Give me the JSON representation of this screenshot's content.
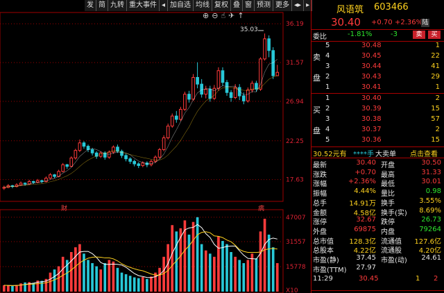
{
  "toolbar": [
    "发",
    "简",
    "九转",
    "重大事件",
    "◂",
    "加自选",
    "均线",
    "复权",
    "叠",
    "窗",
    "预测",
    "更多",
    "◂▸",
    "▸"
  ],
  "top_icons": [
    "⊕",
    "⊖",
    "☝",
    "✈",
    "↑"
  ],
  "header": {
    "name": "风语筑",
    "code": "603466",
    "price": "30.40",
    "change": "+0.70",
    "pct": "+2.36%",
    "tag": "陆"
  },
  "weibi": {
    "label": "委比",
    "pct": "-1.81%",
    "diff": "-3",
    "buy": "买",
    "sell": "卖"
  },
  "sell_orders": [
    {
      "lv": "5",
      "price": "30.48",
      "vol": "1"
    },
    {
      "lv": "4",
      "price": "30.45",
      "vol": "22"
    },
    {
      "lv": "3",
      "price": "30.44",
      "vol": "41"
    },
    {
      "lv": "2",
      "price": "30.43",
      "vol": "29"
    },
    {
      "lv": "1",
      "price": "30.41",
      "vol": "1"
    }
  ],
  "sell_label": [
    "卖",
    "盘"
  ],
  "buy_orders": [
    {
      "lv": "1",
      "price": "30.40",
      "vol": "2"
    },
    {
      "lv": "2",
      "price": "30.39",
      "vol": "15"
    },
    {
      "lv": "3",
      "price": "30.38",
      "vol": "57"
    },
    {
      "lv": "4",
      "price": "30.37",
      "vol": "2"
    },
    {
      "lv": "5",
      "price": "30.36",
      "vol": "15"
    }
  ],
  "buy_label": [
    "买",
    "盘"
  ],
  "big_order": {
    "text1": "30.52元有",
    "text2": "****手",
    "text3": "大卖单",
    "text4": "点击查看"
  },
  "stats": [
    {
      "k1": "最新",
      "v1": "30.40",
      "c1": "red",
      "k2": "开盘",
      "v2": "30.50",
      "c2": "red"
    },
    {
      "k1": "涨跌",
      "v1": "+0.70",
      "c1": "red",
      "k2": "最高",
      "v2": "31.33",
      "c2": "red"
    },
    {
      "k1": "涨幅",
      "v1": "+2.36%",
      "c1": "red",
      "k2": "最低",
      "v2": "30.01",
      "c2": "red"
    },
    {
      "k1": "振幅",
      "v1": "4.44%",
      "c1": "yellow",
      "k2": "量比",
      "v2": "0.98",
      "c2": "green"
    },
    {
      "k1": "总手",
      "v1": "14.91万",
      "c1": "yellow",
      "k2": "换手",
      "v2": "3.55%",
      "c2": "yellow"
    },
    {
      "k1": "金额",
      "v1": "4.58亿",
      "c1": "yellow",
      "k2": "换手(实)",
      "v2": "8.69%",
      "c2": "yellow"
    },
    {
      "k1": "涨停",
      "v1": "32.67",
      "c1": "red",
      "k2": "跌停",
      "v2": "26.73",
      "c2": "green"
    },
    {
      "k1": "外盘",
      "v1": "69875",
      "c1": "red",
      "k2": "内盘",
      "v2": "79264",
      "c2": "green"
    },
    {
      "k1": "总市值",
      "v1": "128.3亿",
      "c1": "yellow",
      "k2": "流通值",
      "v2": "127.6亿",
      "c2": "yellow"
    },
    {
      "k1": "总股本",
      "v1": "4.22亿",
      "c1": "yellow",
      "k2": "流通股",
      "v2": "4.20亿",
      "c2": "yellow"
    },
    {
      "k1": "市盈(静)",
      "v1": "37.45",
      "c1": "white",
      "k2": "市盈(动)",
      "v2": "24.61",
      "c2": "white"
    },
    {
      "k1": "市盈(TTM)",
      "v1": "27.97",
      "c1": "white",
      "k2": "",
      "v2": "",
      "c2": "white"
    }
  ],
  "tick": {
    "time": "11:29",
    "price": "30.45",
    "vol": "1",
    "flag": "2"
  },
  "price_axis": [
    "36.19",
    "31.57",
    "26.94",
    "22.25",
    "17.63"
  ],
  "volume_axis": [
    "47007",
    "31557",
    "15778",
    "X10"
  ],
  "high_label": "35.03",
  "markers": [
    "财",
    "病"
  ],
  "colors": {
    "up": "#ff3b3b",
    "down": "#28c8d8",
    "ma1": "#ffffff",
    "ma2": "#ffd21e",
    "grid": "#a00000"
  },
  "candles": [
    [
      16.6,
      16.7,
      16.4,
      16.9
    ],
    [
      16.7,
      16.9,
      16.6,
      17.1
    ],
    [
      16.9,
      16.8,
      16.6,
      17.0
    ],
    [
      16.8,
      17.0,
      16.7,
      17.2
    ],
    [
      17.0,
      17.2,
      16.9,
      17.4
    ],
    [
      17.2,
      17.1,
      16.9,
      17.3
    ],
    [
      17.1,
      17.4,
      17.0,
      17.6
    ],
    [
      17.4,
      17.3,
      17.1,
      17.5
    ],
    [
      17.3,
      17.5,
      17.2,
      17.7
    ],
    [
      17.5,
      17.4,
      17.2,
      17.6
    ],
    [
      17.4,
      17.8,
      17.3,
      18.0
    ],
    [
      17.8,
      18.2,
      17.7,
      18.4
    ],
    [
      18.2,
      18.0,
      17.8,
      18.3
    ],
    [
      18.0,
      18.6,
      17.9,
      18.8
    ],
    [
      18.6,
      19.4,
      18.5,
      19.6
    ],
    [
      19.4,
      19.2,
      18.9,
      19.5
    ],
    [
      19.2,
      20.2,
      19.1,
      20.4
    ],
    [
      20.2,
      21.1,
      20.0,
      21.3
    ],
    [
      21.1,
      22.0,
      20.9,
      22.4
    ],
    [
      22.0,
      21.6,
      21.3,
      22.2
    ],
    [
      21.6,
      21.2,
      20.9,
      21.8
    ],
    [
      21.2,
      20.8,
      20.5,
      21.4
    ],
    [
      20.8,
      20.4,
      20.1,
      21.0
    ],
    [
      20.4,
      20.8,
      20.2,
      21.0
    ],
    [
      20.8,
      20.3,
      20.0,
      21.0
    ],
    [
      20.3,
      20.9,
      20.1,
      21.1
    ],
    [
      20.9,
      21.5,
      20.7,
      21.7
    ],
    [
      21.5,
      21.0,
      20.8,
      21.8
    ],
    [
      21.0,
      20.5,
      20.2,
      21.2
    ],
    [
      20.5,
      20.1,
      19.8,
      20.7
    ],
    [
      20.1,
      19.8,
      19.5,
      20.3
    ],
    [
      19.8,
      19.5,
      19.2,
      20.0
    ],
    [
      19.5,
      19.3,
      19.0,
      19.7
    ],
    [
      19.3,
      19.6,
      19.1,
      19.8
    ],
    [
      19.6,
      19.4,
      19.1,
      19.8
    ],
    [
      19.4,
      19.8,
      19.2,
      20.0
    ],
    [
      19.8,
      20.3,
      19.6,
      20.5
    ],
    [
      20.3,
      21.2,
      20.1,
      21.4
    ],
    [
      21.2,
      22.6,
      21.0,
      22.9
    ],
    [
      22.6,
      24.0,
      22.4,
      24.3
    ],
    [
      24.0,
      25.2,
      23.8,
      25.5
    ],
    [
      25.2,
      24.8,
      24.4,
      25.8
    ],
    [
      24.8,
      26.0,
      24.6,
      26.3
    ],
    [
      26.0,
      27.8,
      25.8,
      28.1
    ],
    [
      27.8,
      27.2,
      26.8,
      28.2
    ],
    [
      27.2,
      29.8,
      27.0,
      30.2
    ],
    [
      29.8,
      29.0,
      28.5,
      31.6
    ],
    [
      29.0,
      27.8,
      27.4,
      29.6
    ],
    [
      27.8,
      28.4,
      27.3,
      28.8
    ],
    [
      28.4,
      27.3,
      26.9,
      28.8
    ],
    [
      27.3,
      28.5,
      27.1,
      28.9
    ],
    [
      28.5,
      30.6,
      28.2,
      31.0
    ],
    [
      30.6,
      29.2,
      28.8,
      31.0
    ],
    [
      29.2,
      28.0,
      27.6,
      29.5
    ],
    [
      28.0,
      27.4,
      26.9,
      28.3
    ],
    [
      27.4,
      28.6,
      27.2,
      29.0
    ],
    [
      28.6,
      27.6,
      27.1,
      29.0
    ],
    [
      27.6,
      27.0,
      26.6,
      28.0
    ],
    [
      27.0,
      28.3,
      26.8,
      28.6
    ],
    [
      28.3,
      29.1,
      28.0,
      29.4
    ],
    [
      29.1,
      28.4,
      28.1,
      29.4
    ],
    [
      28.4,
      32.0,
      28.2,
      32.2
    ],
    [
      32.0,
      34.4,
      31.8,
      35.03
    ],
    [
      34.4,
      33.0,
      32.2,
      34.8
    ],
    [
      33.0,
      30.0,
      29.6,
      33.4
    ],
    [
      30.0,
      30.4,
      30.0,
      31.3
    ]
  ],
  "volumes": [
    4000,
    3800,
    3500,
    4200,
    5200,
    5800,
    6000,
    5500,
    7000,
    6800,
    8000,
    12000,
    14000,
    16000,
    22000,
    20000,
    25000,
    28000,
    30000,
    24000,
    20000,
    18000,
    16000,
    14000,
    18000,
    20000,
    19000,
    15000,
    12000,
    11000,
    10000,
    9000,
    8500,
    9200,
    8000,
    9500,
    12000,
    15000,
    22000,
    30000,
    42000,
    38000,
    40000,
    45000,
    36000,
    44000,
    47007,
    30000,
    26000,
    24000,
    22000,
    35000,
    32000,
    30000,
    25000,
    22000,
    20000,
    18000,
    20000,
    24000,
    21000,
    38000,
    46000,
    36000,
    28000,
    18000
  ]
}
